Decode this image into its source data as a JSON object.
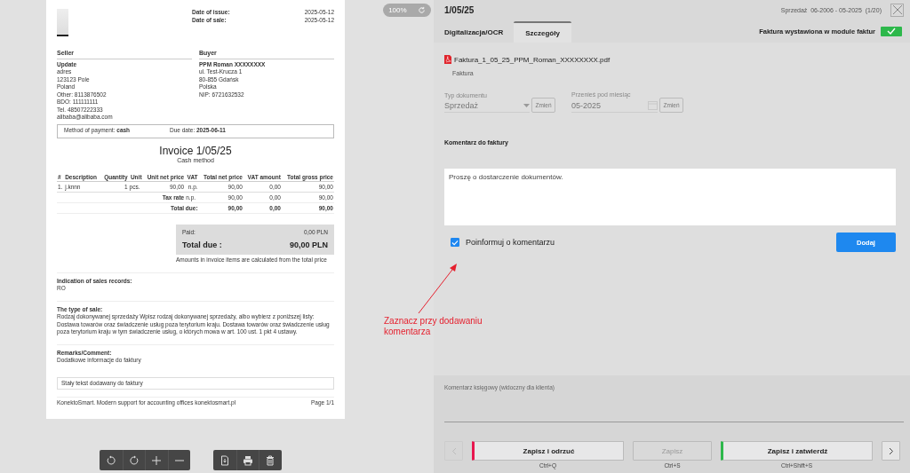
{
  "viewer": {
    "zoom": "100%",
    "invoice": {
      "dates": [
        {
          "label": "Date of issue:",
          "value": "2025-05-12"
        },
        {
          "label": "Date of sale:",
          "value": "2025-05-12"
        }
      ],
      "parties": [
        {
          "heading": "Seller",
          "name": "Update",
          "lines": [
            "adres",
            "123123 Pole",
            "Poland",
            "Other: 8113876502",
            "BDO: 111111111",
            "Tel. 48507222333",
            "alibaba@alibaba.com"
          ]
        },
        {
          "heading": "Buyer",
          "name": "PPM Roman XXXXXXXX",
          "lines": [
            "ul. Test-Krucza 1",
            "80-855 Gdańsk",
            "Polska",
            "NIP: 6721632532"
          ]
        }
      ],
      "payment": "Method of payment: **cash**",
      "due": "Due date: **2025-06-11**",
      "title": "Invoice 1/05/25",
      "subtitle": "Cash method",
      "columns": [
        "#",
        "Description",
        "Quantity",
        "Unit",
        "Unit net price",
        "VAT",
        "Total net price",
        "VAT amount",
        "Total gross price"
      ],
      "rows": [
        [
          "1.",
          "j.knnn",
          "1",
          "pcs.",
          "90,00",
          "n.p.",
          "90,00",
          "0,00",
          "90,00"
        ]
      ],
      "summary": [
        {
          "label": "Tax rate",
          "cells": [
            "n.p.",
            "90,00",
            "0,00",
            "90,00"
          ]
        },
        {
          "label": "Total due:",
          "cells": [
            "90,00",
            "0,00",
            "90,00"
          ]
        }
      ],
      "paid_label": "Paid:",
      "paid_value": "0,00 PLN",
      "total_label": "Total due :",
      "total_value": "90,00 PLN",
      "note": "Amounts in invoice items are calculated from the total price",
      "sections": [
        {
          "heading": "Indication of sales records:",
          "text": "RO"
        },
        {
          "heading": "The type of sale:",
          "text": "Rodzaj dokonywanej sprzedaży Wpisz rodzaj dokonywanej sprzedaży, albo wybierz z poniższej listy: Dostawa towarów oraz świadczenie usług poza terytorium kraju. Dostawa towarów oraz świadczenie usług poza terytorium kraju w tym świadczenie usług, o których mowa w art. 100 ust. 1 pkt 4 ustawy."
        },
        {
          "heading": "Remarks/Comment:",
          "text": "Dodatkowe informacje do faktury"
        }
      ],
      "fixed_text": "Stały tekst dodawany do faktury",
      "footer": "KonektoSmart. Modern support for accounting offices konektosmart.pl",
      "page": "Page 1/1"
    }
  },
  "panel": {
    "title": "1/05/25",
    "period": "Sprzedaż  06-2006 - 05-2025  (1/20)",
    "tabs": [
      {
        "label": "Digitalizacja/OCR",
        "selected": false
      },
      {
        "label": "Szczegóły",
        "selected": true
      }
    ],
    "invoice_module": {
      "label": "Faktura wystawiona w module faktur",
      "checked": true
    },
    "file": {
      "name": "Faktura_1_05_25_PPM_Roman_XXXXXXXX.pdf",
      "type": "Faktura"
    },
    "fields": [
      {
        "label": "Typ dokumentu",
        "value": "Sprzedaż",
        "button": "Zmień",
        "kind": "select",
        "disabled": true
      },
      {
        "label": "Przenieś pod miesiąc",
        "value": "05-2025",
        "button": "Zmień",
        "kind": "date",
        "disabled": true
      }
    ],
    "comment": {
      "heading": "Komentarz do faktury",
      "value": "Proszę o dostarczenie dokumentów.",
      "notify": {
        "label": "Poinformuj o komentarzu",
        "checked": true
      },
      "add_button": "Dodaj"
    },
    "accountant_comment": {
      "label": "Komentarz księgowy (widoczny dla klienta)"
    },
    "prev": {
      "disabled": true
    },
    "next": {
      "disabled": false
    },
    "actions": [
      {
        "label": "Zapisz i odrzuć",
        "shortcut": "Ctrl+Q",
        "kind": "reject",
        "disabled": false
      },
      {
        "label": "Zapisz",
        "shortcut": "Ctrl+S",
        "kind": "plain",
        "disabled": true
      },
      {
        "label": "Zapisz i zatwierdź",
        "shortcut": "Ctrl+Shift+S",
        "kind": "approve",
        "disabled": false
      }
    ]
  },
  "annotation": {
    "text": "Zaznacz przy dodawaniu komentarza"
  }
}
